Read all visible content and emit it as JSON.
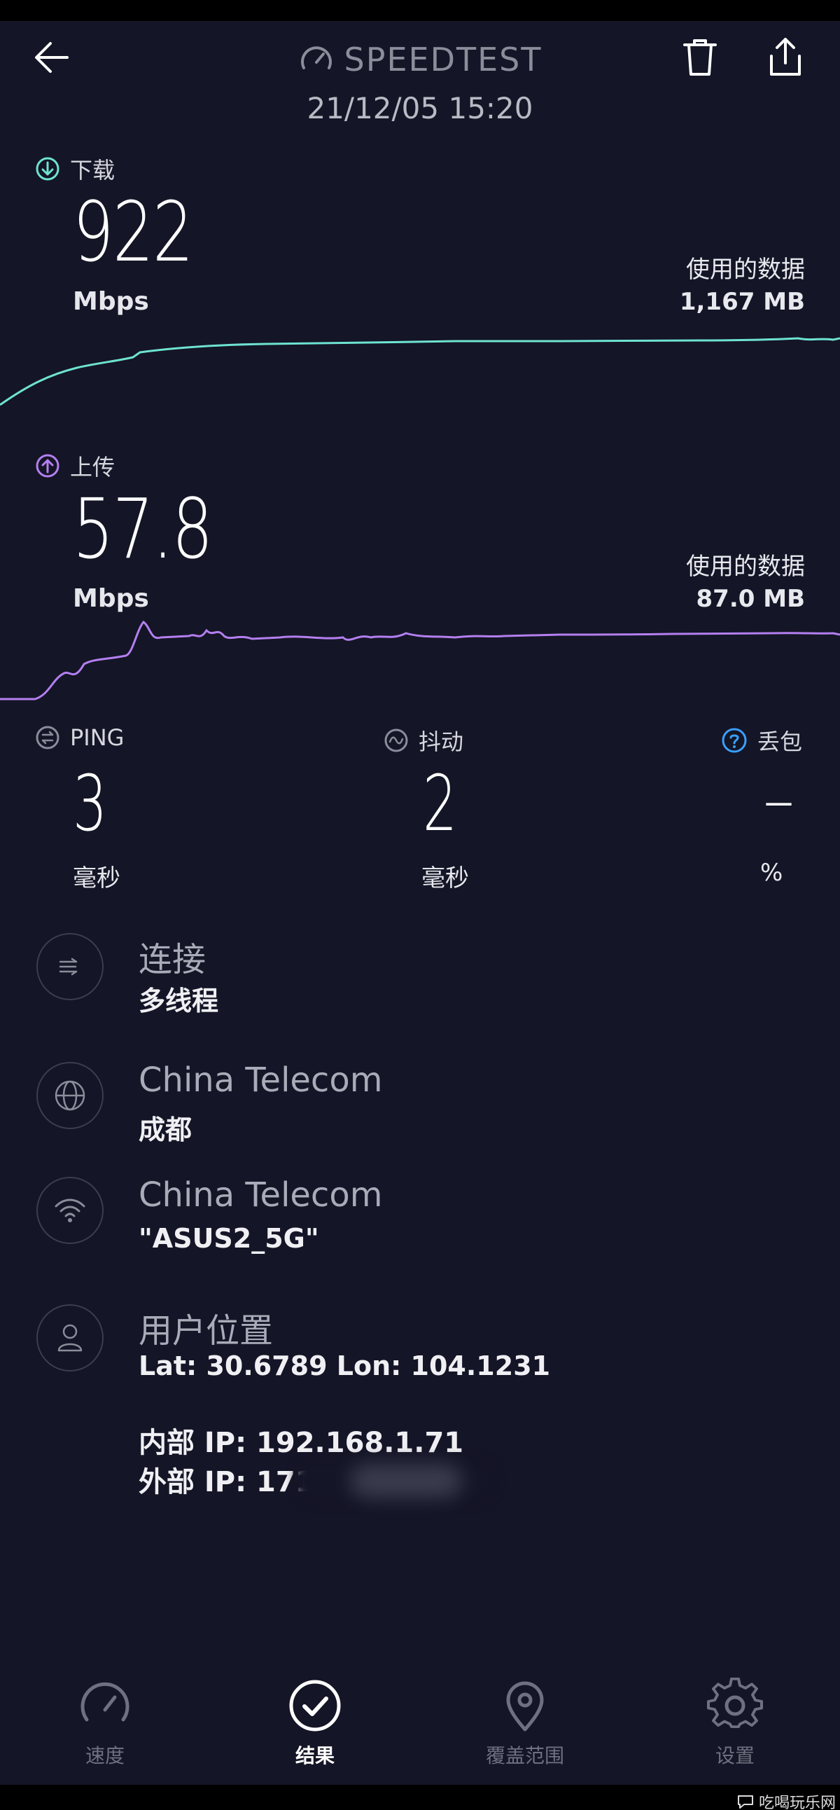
{
  "header": {
    "title": "SPEEDTEST",
    "timestamp": "21/12/05 15:20"
  },
  "download": {
    "label": "下载",
    "value": "922",
    "unit": "Mbps",
    "data_used_label": "使用的数据",
    "data_used_value": "1,167 MB",
    "color": "#6ee3d2"
  },
  "upload": {
    "label": "上传",
    "value": "57.8",
    "unit": "Mbps",
    "data_used_label": "使用的数据",
    "data_used_value": "87.0 MB",
    "color": "#b47ff0"
  },
  "stats": {
    "ping": {
      "label": "PING",
      "value": "3",
      "unit": "毫秒"
    },
    "jitter": {
      "label": "抖动",
      "value": "2",
      "unit": "毫秒"
    },
    "loss": {
      "label": "丢包",
      "value": "–",
      "unit": "%"
    }
  },
  "info": {
    "connection": {
      "title": "连接",
      "subtitle": "多线程",
      "icon": "multi-connection-icon"
    },
    "server": {
      "title": "China Telecom",
      "subtitle": "成都",
      "icon": "globe-icon"
    },
    "network": {
      "title": "China Telecom",
      "subtitle": "\"ASUS2_5G\"",
      "icon": "wifi-icon"
    },
    "location": {
      "title": "用户位置",
      "subtitle": "Lat: 30.6789 Lon: 104.1231",
      "icon": "person-icon"
    },
    "internal_ip": "内部 IP: 192.168.1.71",
    "external_ip": "外部 IP: 171.212"
  },
  "nav": {
    "speed": "速度",
    "results": "结果",
    "coverage": "覆盖范围",
    "settings": "设置"
  },
  "watermark": "吃喝玩乐网",
  "colors": {
    "background": "#141526",
    "download_accent": "#6ee3d2",
    "upload_accent": "#b47ff0",
    "loss_accent": "#3aa0ff"
  }
}
